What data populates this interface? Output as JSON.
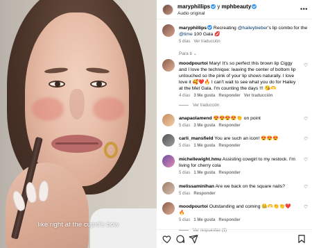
{
  "video": {
    "caption": "like right at the cupid's bow"
  },
  "post": {
    "header": {
      "author": "maryphillips",
      "and": "y",
      "coauthor": "mphbeauty",
      "audio": "Audio original"
    },
    "caption": {
      "username": "maryphillips",
      "text_before": " Recreating ",
      "mention": "@haileybieber",
      "text_middle": "'s lip combo for the ",
      "tag": "@time",
      "text_after": " 100 Gala 💋",
      "time": "5 días",
      "translate": "Ver traducción"
    },
    "sort_label": "Para ti",
    "comments": [
      {
        "username": "moodpourtoi",
        "text": "Mary! It's so perfect this brown lip Ciggy and I love the technique: leaving the center of bottom lip untouched so the pink of your lip shows naturally. I love love it 🥰❤️🔥 I can't wait to see what you do for Hailey at the Met Gala. I'm counting the days !!! 😘🫶",
        "time": "4 días",
        "likes": "3 Me gusta",
        "reply": "Responder",
        "translate": "Ver traducción"
      },
      {
        "username": "anapaolamend",
        "text": "😍😍😍😍👏 on point",
        "time": "5 días",
        "likes": "3 Me gusta",
        "reply": "Responder",
        "translate": ""
      },
      {
        "username": "carli_mansfield",
        "text": "You are such an icon! 😍😍😍",
        "time": "5 días",
        "likes": "1 Me gusta",
        "reply": "Responder",
        "translate": ""
      },
      {
        "username": "michellewight.hmu",
        "text": "Assisting cowgirl to my restock. I'm living for cherry cola",
        "time": "5 días",
        "likes": "1 Me gusta",
        "reply": "Responder",
        "translate": ""
      },
      {
        "username": "melissaminihan",
        "text": "Are we back on the square nails?",
        "time": "5 días",
        "likes": "",
        "reply": "Responder",
        "translate": ""
      },
      {
        "username": "moodpourtoi",
        "text": "Outstanding and coming 🤐🫶👏👏❤️🔥",
        "time": "5 días",
        "likes": "1 Me gusta",
        "reply": "Responder",
        "translate": "Ver respuestas (1)"
      }
    ]
  },
  "colors": {
    "verified": "#3897f0",
    "link": "#00376b",
    "muted": "#737373"
  },
  "icons": {
    "like": "heart-icon",
    "comment": "comment-icon",
    "share": "share-icon",
    "save": "bookmark-icon",
    "more": "more-icon"
  }
}
